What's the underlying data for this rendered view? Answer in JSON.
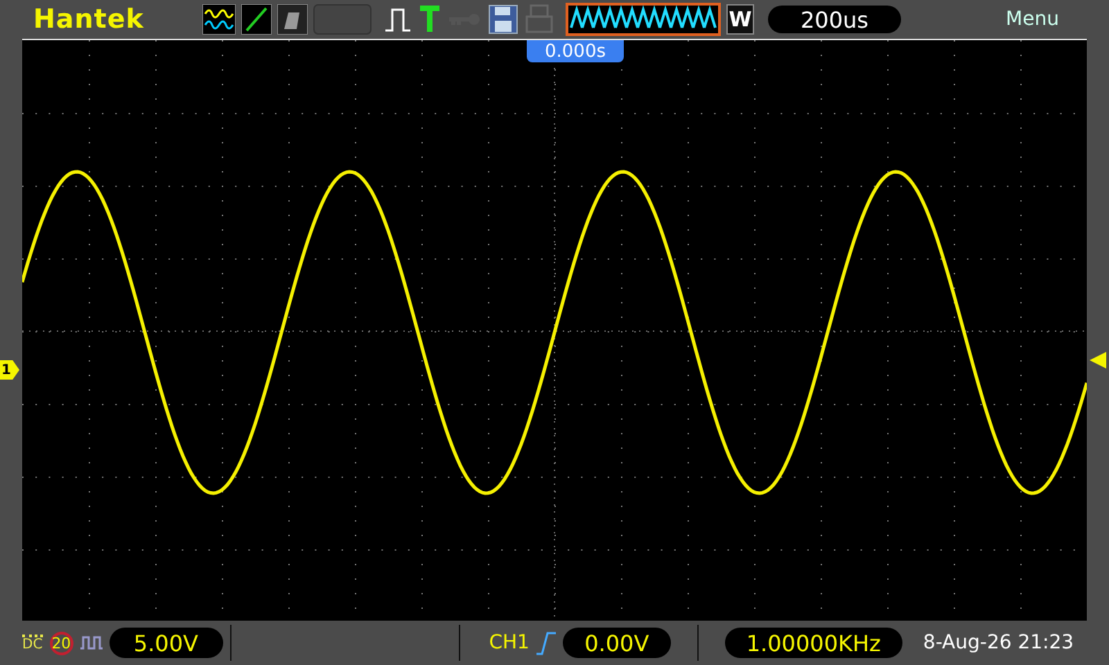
{
  "top_bar": {
    "brand": "Hantek",
    "window_mode": "W",
    "timebase": "200us",
    "menu": "Menu"
  },
  "screen": {
    "trigger_position": "0.000s",
    "channel_marker": "1"
  },
  "bottom_bar": {
    "coupling": "DC",
    "bandwidth_limit": "20",
    "volts_per_div": "5.00V",
    "trigger_source": "CH1",
    "trigger_level": "0.00V",
    "frequency": "1.00000KHz",
    "datetime": "8-Aug-26 21:23"
  }
}
